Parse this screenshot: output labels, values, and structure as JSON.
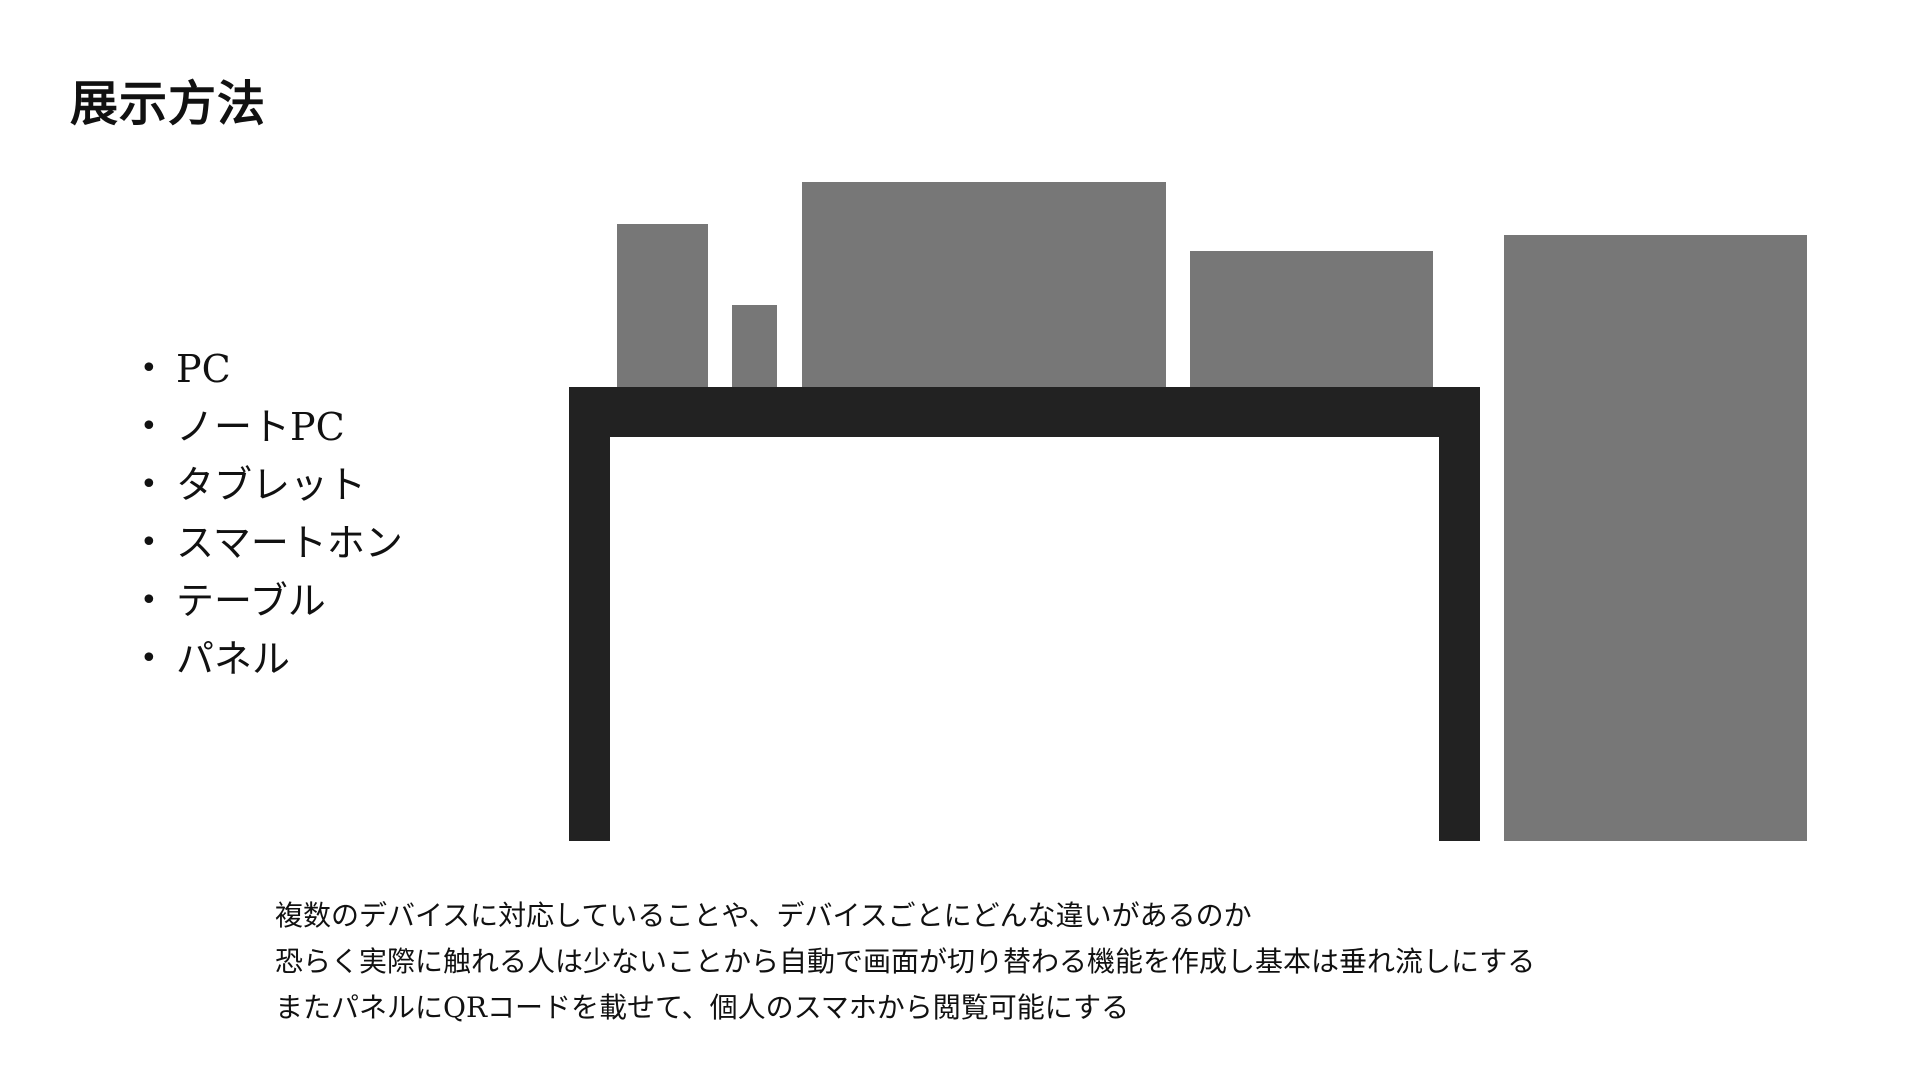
{
  "title": "展示方法",
  "devices": [
    {
      "bullet": "•",
      "label": "PC"
    },
    {
      "bullet": "•",
      "label": "ノートPC"
    },
    {
      "bullet": "•",
      "label": "タブレット"
    },
    {
      "bullet": "•",
      "label": "スマートホン"
    },
    {
      "bullet": "•",
      "label": "テーブル"
    },
    {
      "bullet": "•",
      "label": "パネル"
    }
  ],
  "colors": {
    "device_fill": "#777777",
    "table_fill": "#222222",
    "background": "#ffffff"
  },
  "description": {
    "lines": [
      "複数のデバイスに対応していることや、デバイスごとにどんな違いがあるのか",
      "恐らく実際に触れる人は少ないことから自動で画面が切り替わる機能を作成し基本は垂れ流しにする",
      "またパネルにQRコードを載せて、個人のスマホから閲覧可能にする"
    ]
  }
}
